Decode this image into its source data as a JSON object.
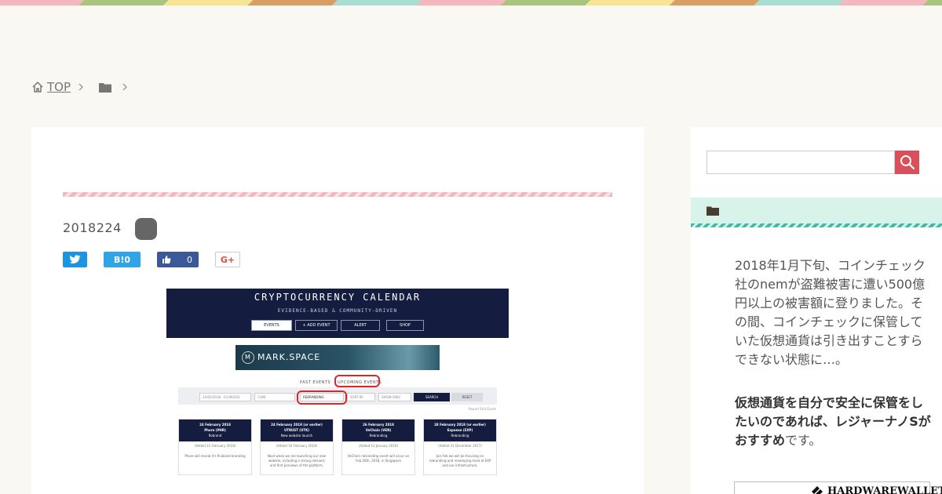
{
  "breadcrumb": {
    "home_label": "TOP"
  },
  "post": {
    "date": "2018224",
    "share": {
      "hatena_label": "B!",
      "hatena_count": "0",
      "like_count": "0",
      "gplus_label": "G+"
    }
  },
  "calendar_shot": {
    "title": "CRYPTOCURRENCY CALENDAR",
    "subtitle": "EVIDENCE-BASED & COMMUNITY-DRIVEN",
    "buttons": [
      "EVENTS",
      "+ ADD EVENT",
      "ALERT",
      "SHOP"
    ],
    "banner": "MARK.SPACE",
    "banner_logo": "M",
    "tabs": {
      "past": "PAST EVENTS",
      "upcoming": "UPCOMING EVENTS"
    },
    "filters": {
      "date": "24/02/2018 - 01/09/202",
      "coin": "COIN",
      "category": "REBRANDING",
      "sort": "SORT BY",
      "show": "SHOW ONLY",
      "search": "SEARCH",
      "reset": "RESET",
      "report": "Report Edit Event"
    },
    "cards": [
      {
        "date": "24 February 2018",
        "coin": "Phore (PHR)",
        "event": "Rebrand",
        "added": "(Added 11 February 2018)",
        "desc": "Phore will reveal it's finalized branding"
      },
      {
        "date": "24 February 2018 (or earlier)",
        "coin": "UTRUST (UTK)",
        "event": "New website launch",
        "added": "(Added 16 February 2018)",
        "desc": "Next week we are launching our new website, including a strong rebrand, and first previews of the platform."
      },
      {
        "date": "26 February 2018",
        "coin": "VeChain (VEN)",
        "event": "Rebranding",
        "added": "(Added 13 January 2018)",
        "desc": "VeChain rebranding event will occur on Feb 26th, 2018, in Singapore"
      },
      {
        "date": "28 February 2018 (or earlier)",
        "coin": "Expanse (EXP)",
        "event": "Rebranding",
        "added": "(Added 21 December 2017)",
        "desc": "Jan-Feb we will be focusing on rebranding and revamping most of EXP and our infrastructure."
      }
    ]
  },
  "sidebar": {
    "search_placeholder": "",
    "intro": "2018年1月下旬、コインチェック社のnemが盗難被害に遭い500億円以上の被害額に登りました。その間、コインチェックに保管していた仮想通貨は引き出すことすらできない状態に…。",
    "reco_bold": "仮想通貨を自分で安全に保管をしたいのであれば、レジャーナノSがおすすめ",
    "reco_tail": "です。",
    "banner_text": "HARDWAREWALLET"
  },
  "colors": {
    "accent_red": "#d9505b",
    "mint": "#d8f3ea",
    "pink": "#f4b7be",
    "navy": "#141d3f"
  }
}
